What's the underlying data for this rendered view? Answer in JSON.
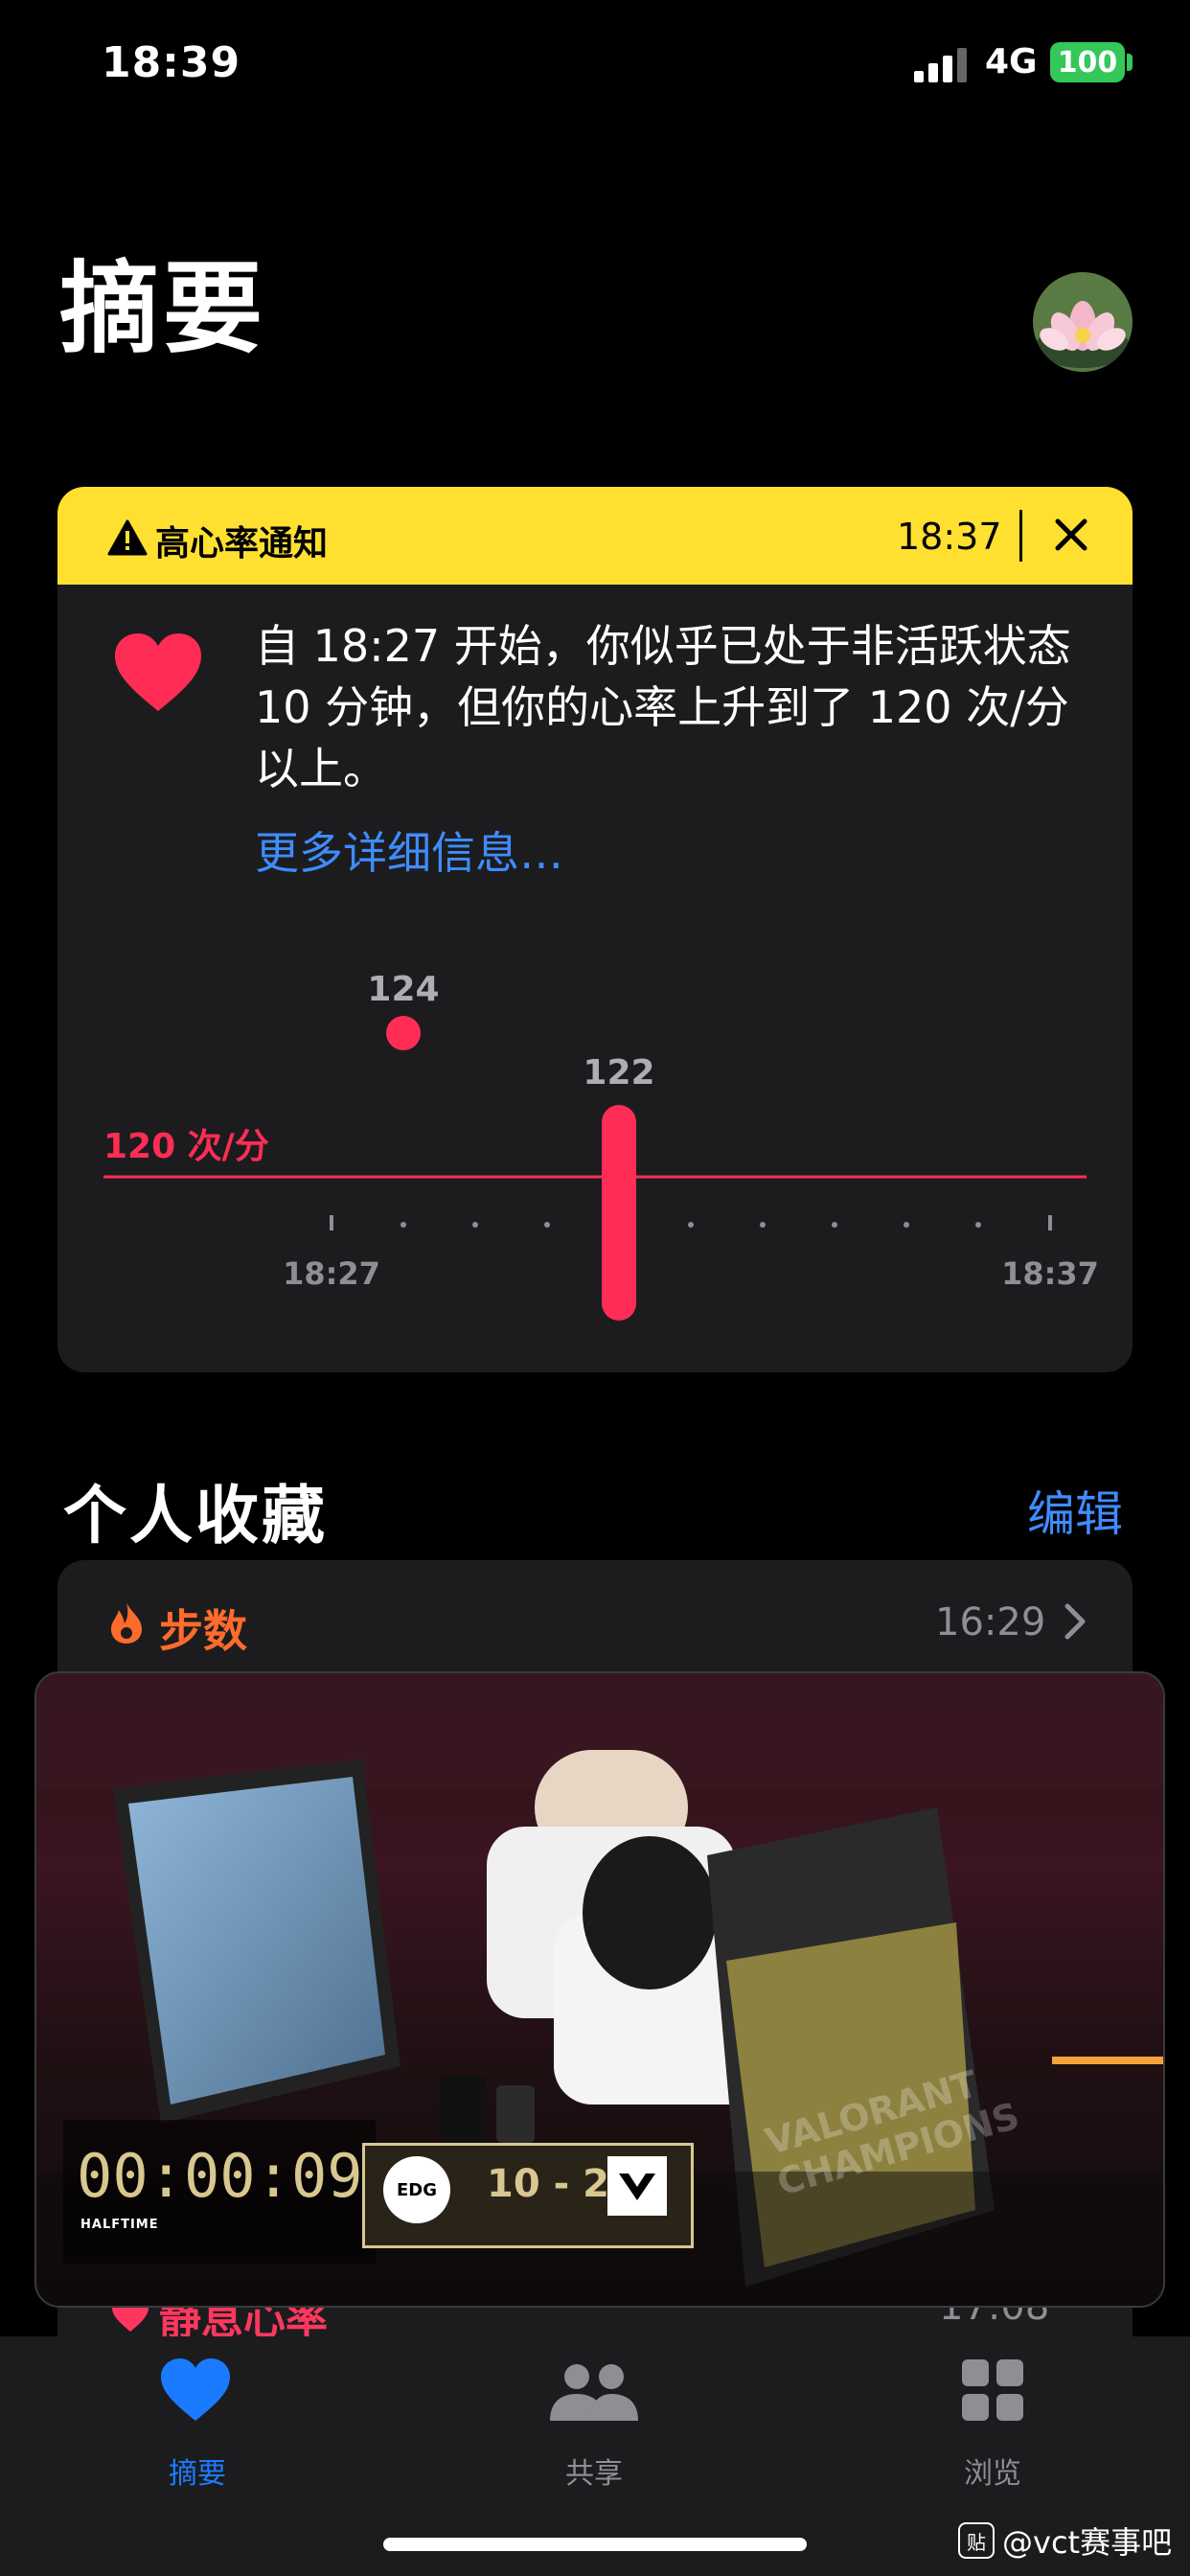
{
  "status_bar": {
    "time": "18:39",
    "network": "4G",
    "battery": "100"
  },
  "header": {
    "title": "摘要"
  },
  "notification": {
    "title": "高心率通知",
    "time": "18:37",
    "body": "自 18:27 开始，你似乎已处于非活跃状态 10 分钟，但你的心率上升到了 120 次/分以上。",
    "more_link": "更多详细信息…",
    "threshold_label": "120 次/分",
    "colors": {
      "banner": "#ffe031",
      "accent": "#ff2d55",
      "link": "#3f8cff"
    }
  },
  "chart_data": {
    "type": "scatter",
    "x_labels": [
      "18:27",
      "18:37"
    ],
    "threshold": 120,
    "threshold_label": "120 次/分",
    "points": [
      {
        "label": "124",
        "x": "18:28",
        "y": 124
      },
      {
        "label": "122",
        "x": "18:31",
        "y_range": [
          116,
          122
        ]
      }
    ]
  },
  "favorites": {
    "title": "个人收藏",
    "edit": "编辑",
    "steps": {
      "label": "步数",
      "time": "16:29"
    },
    "resting_hr": {
      "label": "静息心率",
      "time": "17:08"
    }
  },
  "video": {
    "timer": "00:00:09",
    "phase": "HALFTIME",
    "score": "10 - 2",
    "team_left": "EDG",
    "banner_text": "VALORANT CHAMPIONS"
  },
  "tabs": [
    {
      "label": "摘要",
      "icon": "heart-icon"
    },
    {
      "label": "共享",
      "icon": "people-icon"
    },
    {
      "label": "浏览",
      "icon": "grid-icon"
    }
  ],
  "watermark": "@vct赛事吧"
}
